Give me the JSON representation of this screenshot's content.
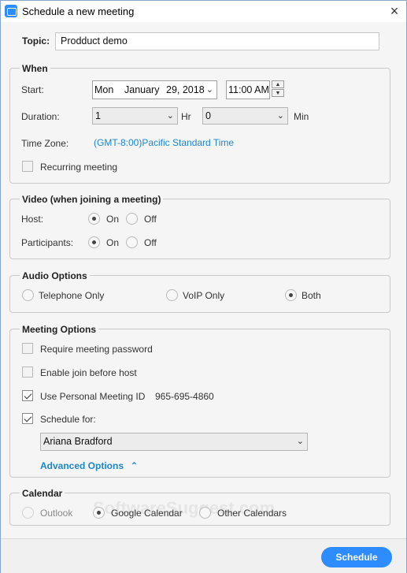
{
  "window": {
    "title": "Schedule a new meeting",
    "close_glyph": "×"
  },
  "topic": {
    "label": "Topic:",
    "value": "Prodduct demo"
  },
  "when": {
    "legend": "When",
    "start_label": "Start:",
    "start_day": "Mon",
    "start_month": "January",
    "start_date": "29, 2018",
    "start_time": "11:00 AM",
    "duration_label": "Duration:",
    "duration_hr": "1",
    "hr_label": "Hr",
    "duration_min": "0",
    "min_label": "Min",
    "timezone_label": "Time Zone:",
    "timezone_value": "(GMT-8:00)Pacific Standard Time",
    "recurring_label": "Recurring meeting",
    "recurring_checked": false
  },
  "video": {
    "legend": "Video (when joining a meeting)",
    "host_label": "Host:",
    "participants_label": "Participants:",
    "on_label": "On",
    "off_label": "Off",
    "host_value": "On",
    "participants_value": "On"
  },
  "audio": {
    "legend": "Audio Options",
    "options": [
      "Telephone Only",
      "VoIP Only",
      "Both"
    ],
    "selected": "Both"
  },
  "meeting_options": {
    "legend": "Meeting Options",
    "require_password": {
      "label": "Require meeting password",
      "checked": false
    },
    "join_before_host": {
      "label": "Enable join before host",
      "checked": false
    },
    "personal_meeting_id": {
      "label": "Use Personal Meeting ID",
      "checked": true,
      "id": "965-695-4860"
    },
    "schedule_for": {
      "label": "Schedule for:",
      "checked": true,
      "value": "Ariana Bradford"
    },
    "advanced_label": "Advanced Options"
  },
  "calendar": {
    "legend": "Calendar",
    "options": [
      "Outlook",
      "Google Calendar",
      "Other Calendars"
    ],
    "selected": "Google Calendar"
  },
  "footer": {
    "schedule_label": "Schedule"
  },
  "watermark": "SoftwareSuggest.com",
  "colors": {
    "accent": "#2d8cff",
    "link": "#1c87c9"
  }
}
